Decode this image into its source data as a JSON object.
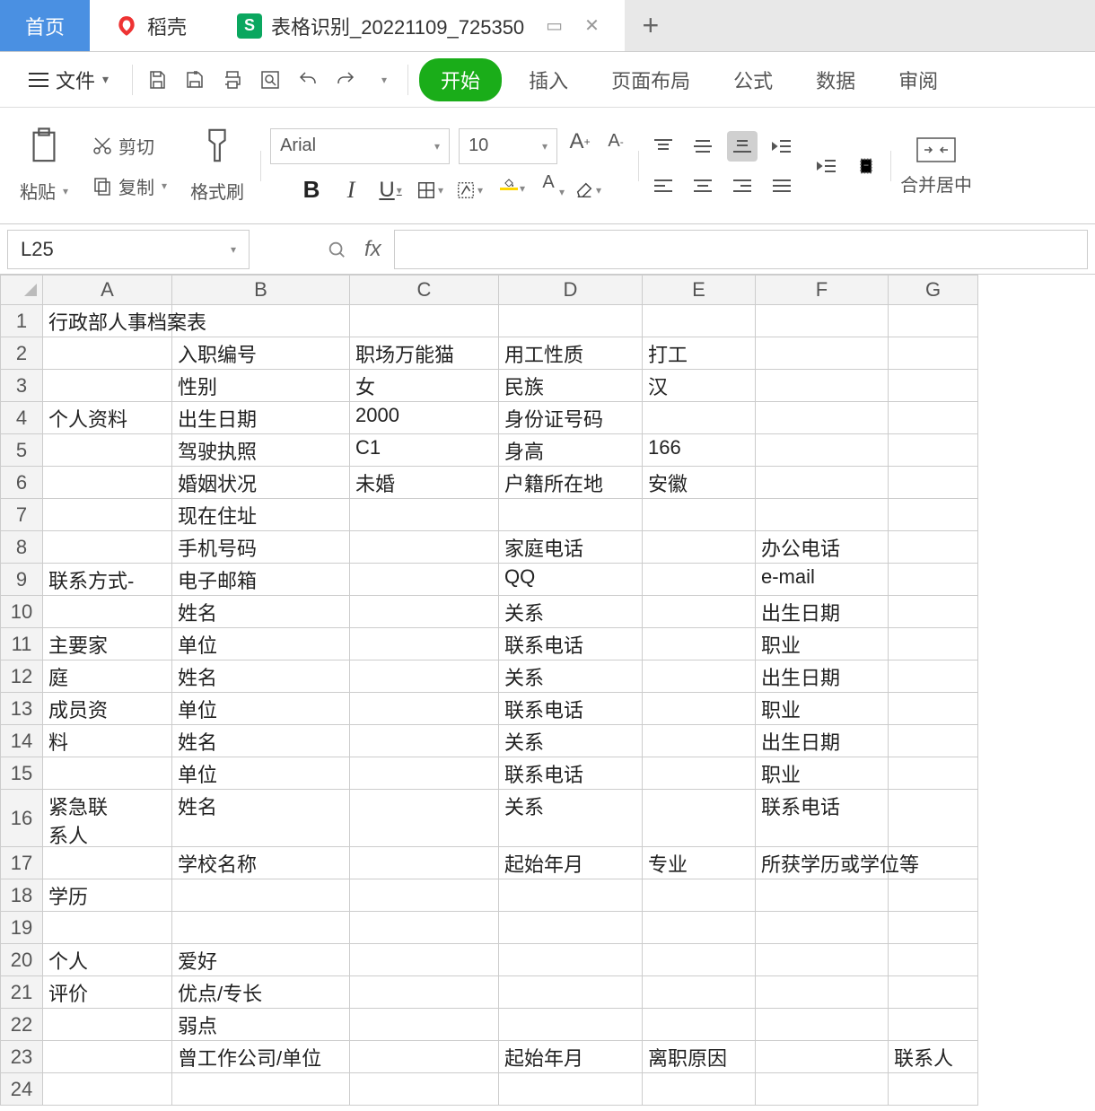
{
  "tabs": {
    "home": "首页",
    "docer": "稻壳",
    "sheet": "表格识别_20221109_725350",
    "plus": "+"
  },
  "menubar": {
    "file": "文件",
    "start": "开始",
    "items": [
      "插入",
      "页面布局",
      "公式",
      "数据",
      "审阅"
    ]
  },
  "ribbon": {
    "paste": "粘贴",
    "cut": "剪切",
    "copy": "复制",
    "brush": "格式刷",
    "font_name": "Arial",
    "font_size": "10",
    "merge": "合并居中"
  },
  "formula": {
    "namebox": "L25",
    "fx": "fx"
  },
  "columns": [
    "A",
    "B",
    "C",
    "D",
    "E",
    "F",
    "G"
  ],
  "rows": [
    "1",
    "2",
    "3",
    "4",
    "5",
    "6",
    "7",
    "8",
    "9",
    "10",
    "11",
    "12",
    "13",
    "14",
    "15",
    "16",
    "17",
    "18",
    "19",
    "20",
    "21",
    "22",
    "23",
    "24"
  ],
  "cells": {
    "A1": "行政部人事档案表",
    "A4": "个人资料",
    "B2": "入职编号",
    "C2": "职场万能猫",
    "D2": "用工性质",
    "E2": "打工",
    "B3": "性别",
    "C3": "女",
    "D3": "民族",
    "E3": "汉",
    "B4": "出生日期",
    "C4": "2000",
    "D4": "身份证号码",
    "B5": "驾驶执照",
    "C5": "C1",
    "D5": "身高",
    "E5": "166",
    "B6": "婚姻状况",
    "C6": "未婚",
    "D6": "户籍所在地",
    "E6": "安徽",
    "B7": "现在住址",
    "B8": "手机号码",
    "D8": "家庭电话",
    "F8": "办公电话",
    "A9": "联系方式-",
    "B9": "电子邮箱",
    "D9": "QQ",
    "F9": "e-mail",
    "B10": "姓名",
    "D10": "关系",
    "F10": "出生日期",
    "A11": "主要家",
    "B11": "单位",
    "D11": "联系电话",
    "F11": "职业",
    "A12": "庭",
    "B12": "姓名",
    "D12": "关系",
    "F12": "出生日期",
    "A13": "成员资",
    "B13": "单位",
    "D13": "联系电话",
    "F13": "职业",
    "A14": "料",
    "B14": "姓名",
    "D14": "关系",
    "F14": "出生日期",
    "B15": "单位",
    "D15": "联系电话",
    "F15": "职业",
    "A16": "紧急联\n系人",
    "B16": "姓名",
    "D16": "关系",
    "F16": "联系电话",
    "B17": "学校名称",
    "D17": "起始年月",
    "E17": "专业",
    "F17": "所获学历或学位等",
    "A18": "学历",
    "A20": "个人",
    "B20": "爱好",
    "A21": "评价",
    "B21": "优点/专长",
    "B22": "弱点",
    "B23": "曾工作公司/单位",
    "D23": "起始年月",
    "E23": "离职原因",
    "G23": "联系人"
  }
}
